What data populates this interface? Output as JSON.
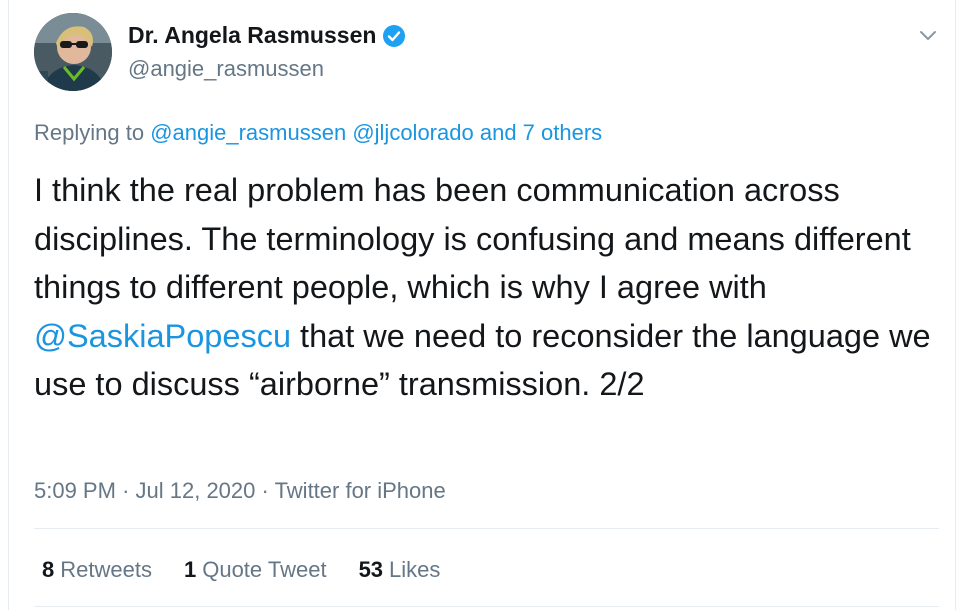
{
  "author": {
    "display_name": "Dr. Angela Rasmussen",
    "handle": "@angie_rasmussen",
    "verified": true
  },
  "replying": {
    "prefix": "Replying to",
    "mentions": [
      "@angie_rasmussen",
      "@jljcolorado"
    ],
    "others": "and 7 others"
  },
  "tweet": {
    "text_before": "I think the real problem has been communication across disciplines. The terminology is confusing and means different things to different people, which is why I agree with ",
    "mention": "@SaskiaPopescu",
    "text_after": " that we need to reconsider the language we use to discuss “airborne” transmission. 2/2"
  },
  "meta": {
    "time": "5:09 PM",
    "date": "Jul 12, 2020",
    "source": "Twitter for iPhone",
    "separator": "·"
  },
  "stats": {
    "retweets_count": "8",
    "retweets_label": "Retweets",
    "quotes_count": "1",
    "quotes_label": "Quote Tweet",
    "likes_count": "53",
    "likes_label": "Likes"
  },
  "colors": {
    "link": "#1b95e0",
    "secondary_text": "#657786",
    "primary_text": "#14171a",
    "verified_badge": "#1da1f2",
    "divider": "#e6ecf0"
  },
  "icons": {
    "verified": "verified-badge-icon",
    "menu": "chevron-down-icon"
  }
}
